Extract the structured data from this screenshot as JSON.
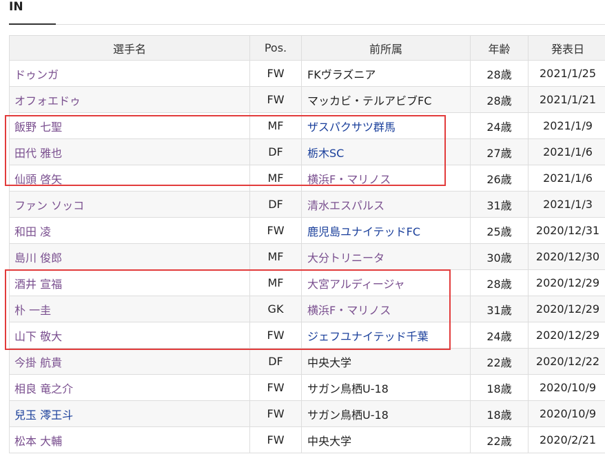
{
  "section": {
    "title": "IN"
  },
  "table": {
    "headers": {
      "name": "選手名",
      "pos": "Pos.",
      "club": "前所属",
      "age": "年齢",
      "date": "発表日"
    },
    "rows": [
      {
        "name": "ドゥンガ",
        "pos": "FW",
        "club": "FKヴラズニア",
        "age": "28歳",
        "date": "2021/1/25"
      },
      {
        "name": "オフォエドゥ",
        "pos": "FW",
        "club": "マッカビ・テルアビブFC",
        "age": "28歳",
        "date": "2021/1/21"
      },
      {
        "name": "飯野 七聖",
        "pos": "MF",
        "club": "ザスパクサツ群馬",
        "age": "24歳",
        "date": "2021/1/9"
      },
      {
        "name": "田代 雅也",
        "pos": "DF",
        "club": "栃木SC",
        "age": "27歳",
        "date": "2021/1/6"
      },
      {
        "name": "仙頭 啓矢",
        "pos": "MF",
        "club": "横浜F・マリノス",
        "age": "26歳",
        "date": "2021/1/6"
      },
      {
        "name": "ファン ソッコ",
        "pos": "DF",
        "club": "清水エスパルス",
        "age": "31歳",
        "date": "2021/1/3"
      },
      {
        "name": "和田 凌",
        "pos": "FW",
        "club": "鹿児島ユナイテッドFC",
        "age": "25歳",
        "date": "2020/12/31"
      },
      {
        "name": "島川 俊郎",
        "pos": "MF",
        "club": "大分トリニータ",
        "age": "30歳",
        "date": "2020/12/30"
      },
      {
        "name": "酒井 宣福",
        "pos": "MF",
        "club": "大宮アルディージャ",
        "age": "28歳",
        "date": "2020/12/29"
      },
      {
        "name": "朴 一圭",
        "pos": "GK",
        "club": "横浜F・マリノス",
        "age": "31歳",
        "date": "2020/12/29"
      },
      {
        "name": "山下 敬大",
        "pos": "FW",
        "club": "ジェフユナイテッド千葉",
        "age": "24歳",
        "date": "2020/12/29"
      },
      {
        "name": "今掛 航貴",
        "pos": "DF",
        "club": "中央大学",
        "age": "22歳",
        "date": "2020/12/22"
      },
      {
        "name": "相良 竜之介",
        "pos": "FW",
        "club": "サガン鳥栖U-18",
        "age": "18歳",
        "date": "2020/10/9"
      },
      {
        "name": "兒玉 澪王斗",
        "pos": "FW",
        "club": "サガン鳥栖U-18",
        "age": "18歳",
        "date": "2020/10/9"
      },
      {
        "name": "松本 大輔",
        "pos": "FW",
        "club": "中央大学",
        "age": "22歳",
        "date": "2020/2/21"
      }
    ]
  },
  "styles": {
    "name_colors": [
      "#7a4f8f",
      "#7a4f8f",
      "#7a4f8f",
      "#7a4f8f",
      "#7a4f8f",
      "#7a4f8f",
      "#7a4f8f",
      "#7a4f8f",
      "#7a4f8f",
      "#7a4f8f",
      "#7a4f8f",
      "#7a4f8f",
      "#7a4f8f",
      "#1a3f9b",
      "#7a4f8f"
    ],
    "club_colors": [
      "#222222",
      "#222222",
      "#1a3f9b",
      "#1a3f9b",
      "#7a4f8f",
      "#7a4f8f",
      "#1a3f9b",
      "#7a4f8f",
      "#7a4f8f",
      "#7a4f8f",
      "#1a3f9b",
      "#222222",
      "#222222",
      "#222222",
      "#222222"
    ],
    "highlight_color": "#e23b3b"
  }
}
